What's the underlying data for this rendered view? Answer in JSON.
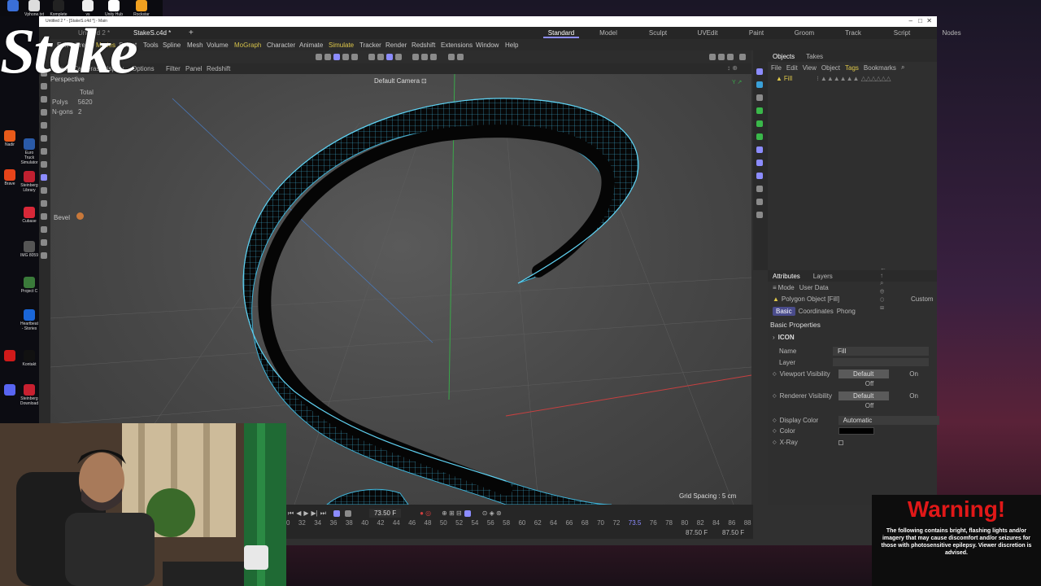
{
  "desktop": {
    "top_icons": [
      "Vphone.txt",
      "Komplete",
      "vs",
      "Unity Hub",
      "Rockstar"
    ],
    "left_icons": [
      "Nadir",
      "Euro Truck Simulator",
      "Brave",
      "Steinberg Library",
      "Cubase",
      "IMG 8059",
      "Project C",
      "Heartbeat - Stories",
      "Kontakt",
      "Steinberg Download"
    ]
  },
  "window": {
    "title": "Untitled 2 * - [StakeS.c4d *] - Main",
    "doc_tabs": [
      {
        "label": "Untitled 2 *"
      },
      {
        "label": "StakeS.c4d *"
      }
    ],
    "layouts": [
      "Standard",
      "Model",
      "Sculpt",
      "UVEdit",
      "Paint",
      "Groom",
      "Track",
      "Script",
      "Nodes"
    ],
    "active_layout": "Standard"
  },
  "menus": [
    "File",
    "Edit",
    "Create",
    "Modes",
    "Select",
    "Tools",
    "Spline",
    "Mesh",
    "Volume",
    "MoGraph",
    "Character",
    "Animate",
    "Simulate",
    "Tracker",
    "Render",
    "Redshift",
    "Extensions",
    "Window",
    "Help"
  ],
  "viewport": {
    "menu": [
      "View",
      "Cameras",
      "Display",
      "Options",
      "Filter",
      "Panel",
      "Redshift"
    ],
    "label": "Perspective",
    "camera": "Default Camera",
    "stats": {
      "total_label": "Total",
      "polys_label": "Polys",
      "polys_value": "5620",
      "ngons_label": "N-gons",
      "ngons_value": "2"
    },
    "grid_spacing": "Grid Spacing : 5 cm",
    "bevel_label": "Bevel"
  },
  "objects_panel": {
    "tabs": [
      "Objects",
      "Takes"
    ],
    "menu": [
      "File",
      "Edit",
      "View",
      "Object",
      "Tags",
      "Bookmarks"
    ],
    "items": [
      {
        "name": "Fill"
      }
    ]
  },
  "attributes": {
    "tabs": [
      "Attributes",
      "Layers"
    ],
    "mode_menu": [
      "Mode",
      "User Data"
    ],
    "object_title": "Polygon Object [Fill]",
    "preset": "Custom",
    "subtabs": [
      "Basic",
      "Coordinates",
      "Phong"
    ],
    "section": "Basic Properties",
    "icon_label": "ICON",
    "fields": {
      "name_label": "Name",
      "name_value": "Fill",
      "layer_label": "Layer",
      "viewport_vis_label": "Viewport Visibility",
      "renderer_vis_label": "Renderer Visibility",
      "opt_default": "Default",
      "opt_on": "On",
      "opt_off": "Off",
      "display_color_label": "Display Color",
      "display_color_value": "Automatic",
      "color_label": "Color",
      "xray_label": "X-Ray"
    }
  },
  "timeline": {
    "current_frame": "73.50 F",
    "ticks": [
      "0",
      "32",
      "34",
      "36",
      "38",
      "40",
      "42",
      "44",
      "46",
      "48",
      "50",
      "52",
      "54",
      "56",
      "58",
      "60",
      "62",
      "64",
      "66",
      "68",
      "70",
      "72",
      "73.5",
      "76",
      "78",
      "80",
      "82",
      "84",
      "86",
      "88"
    ],
    "end_frame": "87.50 F",
    "end_frame2": "87.50 F"
  },
  "overlay": {
    "logo": "Stake",
    "warning_title": "Warning!",
    "warning_text": "The following contains bright, flashing lights and/or imagery that may cause discomfort and/or seizures for those with photosensitive epilepsy. Viewer discretion is advised."
  },
  "colors": {
    "accent": "#8c8cff",
    "mograph": "#d4c14a",
    "simulate": "#e0c94a",
    "wire": "#3fb3d8",
    "warning": "#e01818"
  }
}
